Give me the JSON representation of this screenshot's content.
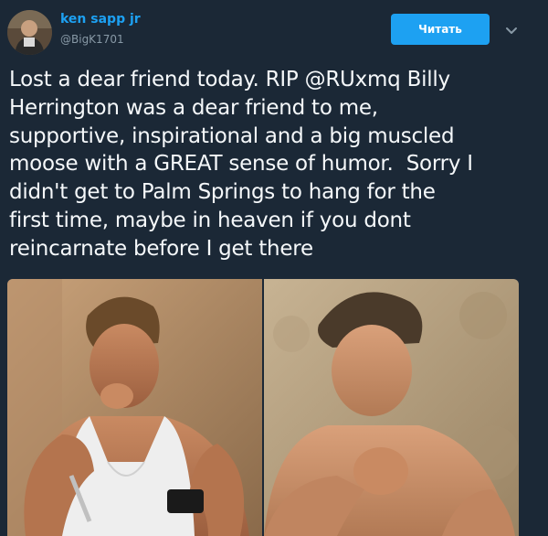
{
  "author": {
    "display_name": "ken sapp jr",
    "username": "@BigK1701"
  },
  "follow_button": {
    "label": "Читать"
  },
  "menu": {
    "icon": "chevron-down-icon"
  },
  "tweet": {
    "text": "Lost a dear friend today. RIP @RUxmq Billy\nHerrington was a dear friend to me,\nsupportive, inspirational and a big muscled\nmoose with a GREAT sense of humor.  Sorry I\ndidn't get to Palm Springs to hang for the\nfirst time, maybe in heaven if you dont\nreincarnate before I get there"
  },
  "media": {
    "photos": [
      {
        "icon": "photo-man-white-tank-top"
      },
      {
        "icon": "photo-man-rocky-background"
      }
    ]
  },
  "colors": {
    "background": "#1b2836",
    "accent": "#1da1f2",
    "muted": "#8899a6",
    "text": "#f5f8fa"
  }
}
